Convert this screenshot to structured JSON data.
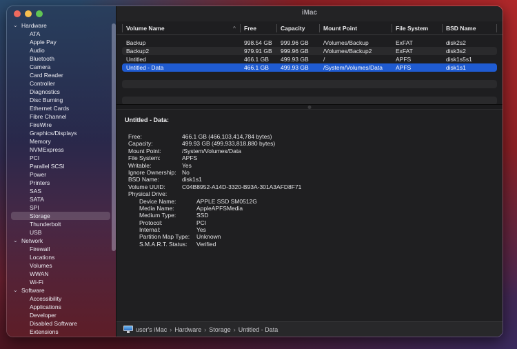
{
  "window": {
    "title": "iMac"
  },
  "sidebar": {
    "groups": [
      {
        "label": "Hardware",
        "items": [
          "ATA",
          "Apple Pay",
          "Audio",
          "Bluetooth",
          "Camera",
          "Card Reader",
          "Controller",
          "Diagnostics",
          "Disc Burning",
          "Ethernet Cards",
          "Fibre Channel",
          "FireWire",
          "Graphics/Displays",
          "Memory",
          "NVMExpress",
          "PCI",
          "Parallel SCSI",
          "Power",
          "Printers",
          "SAS",
          "SATA",
          "SPI",
          "Storage",
          "Thunderbolt",
          "USB"
        ]
      },
      {
        "label": "Network",
        "items": [
          "Firewall",
          "Locations",
          "Volumes",
          "WWAN",
          "Wi-Fi"
        ]
      },
      {
        "label": "Software",
        "items": [
          "Accessibility",
          "Applications",
          "Developer",
          "Disabled Software",
          "Extensions"
        ]
      }
    ],
    "selected": "Storage"
  },
  "table": {
    "columns": [
      "Volume Name",
      "Free",
      "Capacity",
      "Mount Point",
      "File System",
      "BSD Name"
    ],
    "sort_column": "Volume Name",
    "rows": [
      {
        "name": "Backup",
        "free": "998.54 GB",
        "capacity": "999.96 GB",
        "mount": "/Volumes/Backup",
        "fs": "ExFAT",
        "bsd": "disk2s2"
      },
      {
        "name": "Backup2",
        "free": "979.91 GB",
        "capacity": "999.96 GB",
        "mount": "/Volumes/Backup2",
        "fs": "ExFAT",
        "bsd": "disk3s2"
      },
      {
        "name": "Untitled",
        "free": "466.1 GB",
        "capacity": "499.93 GB",
        "mount": "/",
        "fs": "APFS",
        "bsd": "disk1s5s1"
      },
      {
        "name": "Untitled - Data",
        "free": "466.1 GB",
        "capacity": "499.93 GB",
        "mount": "/System/Volumes/Data",
        "fs": "APFS",
        "bsd": "disk1s1"
      }
    ],
    "selected_index": 3
  },
  "detail": {
    "title": "Untitled - Data:",
    "fields": [
      {
        "k": "Free:",
        "v": "466.1 GB (466,103,414,784 bytes)"
      },
      {
        "k": "Capacity:",
        "v": "499.93 GB (499,933,818,880 bytes)"
      },
      {
        "k": "Mount Point:",
        "v": "/System/Volumes/Data"
      },
      {
        "k": "File System:",
        "v": "APFS"
      },
      {
        "k": "Writable:",
        "v": "Yes"
      },
      {
        "k": "Ignore Ownership:",
        "v": "No"
      },
      {
        "k": "BSD Name:",
        "v": "disk1s1"
      },
      {
        "k": "Volume UUID:",
        "v": "C04B8952-A14D-3320-B93A-301A3AFD8F71"
      },
      {
        "k": "Physical Drive:",
        "v": ""
      }
    ],
    "physical_drive": [
      {
        "k": "Device Name:",
        "v": "APPLE SSD SM0512G"
      },
      {
        "k": "Media Name:",
        "v": "AppleAPFSMedia"
      },
      {
        "k": "Medium Type:",
        "v": "SSD"
      },
      {
        "k": "Protocol:",
        "v": "PCI"
      },
      {
        "k": "Internal:",
        "v": "Yes"
      },
      {
        "k": "Partition Map Type:",
        "v": "Unknown"
      },
      {
        "k": "S.M.A.R.T. Status:",
        "v": "Verified"
      }
    ]
  },
  "statusbar": {
    "icon": "imac-icon",
    "path": [
      "user's iMac",
      "Hardware",
      "Storage",
      "Untitled - Data"
    ],
    "separator": "›"
  },
  "colors": {
    "selection": "#1f5bd1",
    "close": "#ed6a5e",
    "minimize": "#f5bf4f",
    "maximize": "#61c554"
  }
}
